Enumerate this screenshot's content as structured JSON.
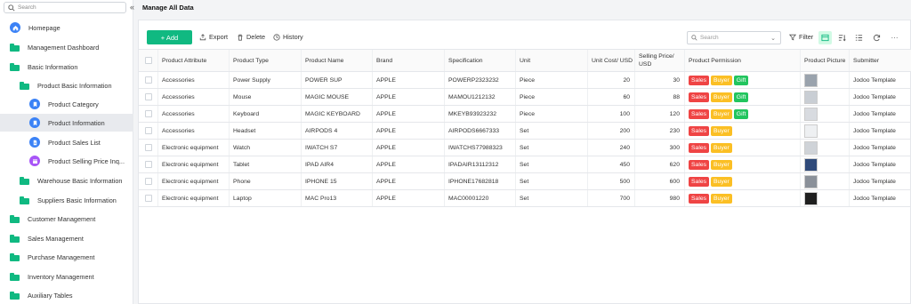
{
  "sidebar": {
    "search_placeholder": "Search",
    "collapse": "«",
    "items": [
      {
        "label": "Homepage",
        "icon": "home-icon"
      },
      {
        "label": "Management Dashboard",
        "icon": "folder-icon"
      },
      {
        "label": "Basic Information",
        "icon": "folder-icon"
      },
      {
        "label": "Product Basic Information",
        "icon": "folder-icon"
      },
      {
        "label": "Product Category",
        "icon": "bookmark-icon"
      },
      {
        "label": "Product Information",
        "icon": "bookmark-icon"
      },
      {
        "label": "Product Sales List",
        "icon": "document-icon"
      },
      {
        "label": "Product Selling Price Inq...",
        "icon": "calendar-icon"
      },
      {
        "label": "Warehouse Basic Information",
        "icon": "folder-icon"
      },
      {
        "label": "Suppliers Basic Information",
        "icon": "folder-icon"
      },
      {
        "label": "Customer Management",
        "icon": "folder-icon"
      },
      {
        "label": "Sales Management",
        "icon": "folder-icon"
      },
      {
        "label": "Purchase Management",
        "icon": "folder-icon"
      },
      {
        "label": "Inventory Management",
        "icon": "folder-icon"
      },
      {
        "label": "Auxiliary Tables",
        "icon": "folder-icon"
      }
    ]
  },
  "header": {
    "title": "Manage All Data"
  },
  "toolbar": {
    "add_label": "+ Add",
    "export_label": "Export",
    "delete_label": "Delete",
    "history_label": "History",
    "search_placeholder": "Search",
    "filter_label": "Filter",
    "more": "···"
  },
  "table": {
    "columns": [
      "Product Attribute",
      "Product Type",
      "Product Name",
      "Brand",
      "Specification",
      "Unit",
      "Unit Cost/ USD",
      "Selling Price/ USD",
      "Product Permission",
      "Product Picture",
      "Submitter"
    ],
    "rows": [
      {
        "attr": "Accessories",
        "type": "Power Supply",
        "name": "POWER SUP",
        "brand": "APPLE",
        "spec": "POWERP2323232",
        "unit": "Piece",
        "cost": "20",
        "price": "30",
        "perms": [
          "Sales",
          "Buyer",
          "Gift"
        ],
        "submitter": "Jodoo Template"
      },
      {
        "attr": "Accessories",
        "type": "Mouse",
        "name": "MAGIC MOUSE",
        "brand": "APPLE",
        "spec": "MAMOU1212132",
        "unit": "Piece",
        "cost": "60",
        "price": "88",
        "perms": [
          "Sales",
          "Buyer",
          "Gift"
        ],
        "submitter": "Jodoo Template"
      },
      {
        "attr": "Accessories",
        "type": "Keyboard",
        "name": "MAGIC KEYBOARD",
        "brand": "APPLE",
        "spec": "MKEYB93923232",
        "unit": "Piece",
        "cost": "100",
        "price": "120",
        "perms": [
          "Sales",
          "Buyer",
          "Gift"
        ],
        "submitter": "Jodoo Template"
      },
      {
        "attr": "Accessories",
        "type": "Headset",
        "name": "AIRPODS 4",
        "brand": "APPLE",
        "spec": "AIRPODS6667333",
        "unit": "Set",
        "cost": "200",
        "price": "230",
        "perms": [
          "Sales",
          "Buyer"
        ],
        "submitter": "Jodoo Template"
      },
      {
        "attr": "Electronic equipment",
        "type": "Watch",
        "name": "IWATCH S7",
        "brand": "APPLE",
        "spec": "IWATCHS77988323",
        "unit": "Set",
        "cost": "240",
        "price": "300",
        "perms": [
          "Sales",
          "Buyer"
        ],
        "submitter": "Jodoo Template"
      },
      {
        "attr": "Electronic equipment",
        "type": "Tablet",
        "name": "IPAD AIR4",
        "brand": "APPLE",
        "spec": "IPADAIR13112312",
        "unit": "Set",
        "cost": "450",
        "price": "620",
        "perms": [
          "Sales",
          "Buyer"
        ],
        "submitter": "Jodoo Template"
      },
      {
        "attr": "Electronic equipment",
        "type": "Phone",
        "name": "IPHONE 15",
        "brand": "APPLE",
        "spec": "IPHONE17682818",
        "unit": "Set",
        "cost": "500",
        "price": "600",
        "perms": [
          "Sales",
          "Buyer"
        ],
        "submitter": "Jodoo Template"
      },
      {
        "attr": "Electronic equipment",
        "type": "Laptop",
        "name": "MAC Pro13",
        "brand": "APPLE",
        "spec": "MAC00001220",
        "unit": "Set",
        "cost": "700",
        "price": "980",
        "perms": [
          "Sales",
          "Buyer"
        ],
        "submitter": "Jodoo Template"
      }
    ]
  },
  "colors": {
    "accent": "#10b981",
    "sales": "#ef4444",
    "buyer": "#fbbf24",
    "gift": "#22c55e"
  }
}
